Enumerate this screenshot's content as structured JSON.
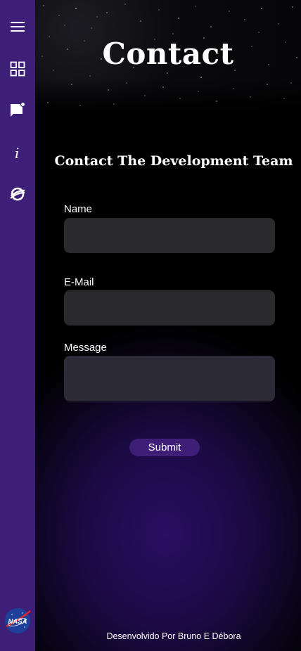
{
  "page": {
    "title": "Contact",
    "section_title": "Contact The Development Team"
  },
  "form": {
    "name_label": "Name",
    "name_value": "",
    "email_label": "E-Mail",
    "email_value": "",
    "message_label": "Message",
    "message_value": "",
    "submit_label": "Submit"
  },
  "sidebar": {
    "items": [
      {
        "icon": "menu-icon"
      },
      {
        "icon": "dashboard-icon"
      },
      {
        "icon": "feedback-icon"
      },
      {
        "icon": "info-icon"
      },
      {
        "icon": "planet-icon"
      }
    ],
    "logo_text": "NASA"
  },
  "footer": {
    "text": "Desenvolvido Por Bruno E Débora"
  },
  "colors": {
    "sidebar": "#3d1f78",
    "input_bg": "#2a2a2d",
    "button": "#3d1f78",
    "background": "#000000"
  }
}
